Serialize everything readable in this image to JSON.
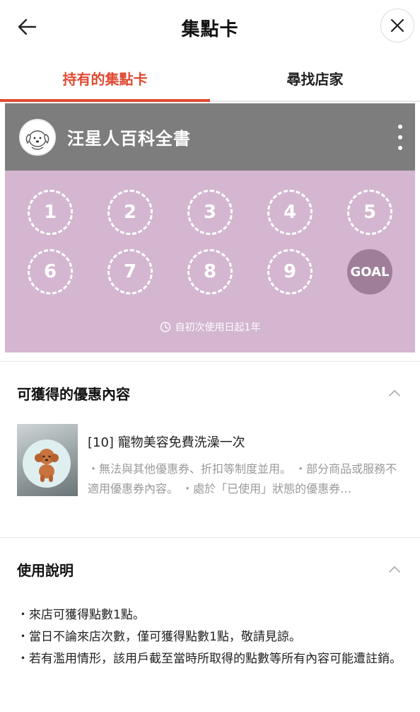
{
  "header": {
    "title": "集點卡",
    "back_icon": "arrow-left-icon",
    "close_icon": "close-icon"
  },
  "tabs": [
    {
      "label": "持有的集點卡",
      "active": true
    },
    {
      "label": "尋找店家",
      "active": false
    }
  ],
  "card": {
    "shop_name": "汪星人百科全書",
    "avatar_icon": "dog-avatar-icon",
    "more_icon": "more-vertical-icon",
    "stamps": [
      "1",
      "2",
      "3",
      "4",
      "5",
      "6",
      "7",
      "8",
      "9",
      "GOAL"
    ],
    "validity": "自初次使用日起1年",
    "validity_icon": "clock-icon",
    "colors": {
      "header": "#7d7d7d",
      "body": "#d4b6d0",
      "goal": "#9e7e99"
    }
  },
  "benefits": {
    "title": "可獲得的優惠內容",
    "chevron_icon": "chevron-up-icon",
    "coupon": {
      "title": "[10] 寵物美容免費洗澡一次",
      "desc": "・無法與其他優惠券、折扣等制度並用。 ・部分商品或服務不適用優惠券內容。 ・處於「已使用」狀態的優惠券…",
      "image_icon": "poodle-icon"
    }
  },
  "usage": {
    "title": "使用說明",
    "chevron_icon": "chevron-up-icon",
    "items": [
      "・來店可獲得點數1點。",
      "・當日不論來店次數，僅可獲得點數1點，敬請見諒。",
      "・若有濫用情形，該用戶截至當時所取得的點數等所有內容可能遭註銷。"
    ]
  },
  "accent_color": "#e04a33"
}
